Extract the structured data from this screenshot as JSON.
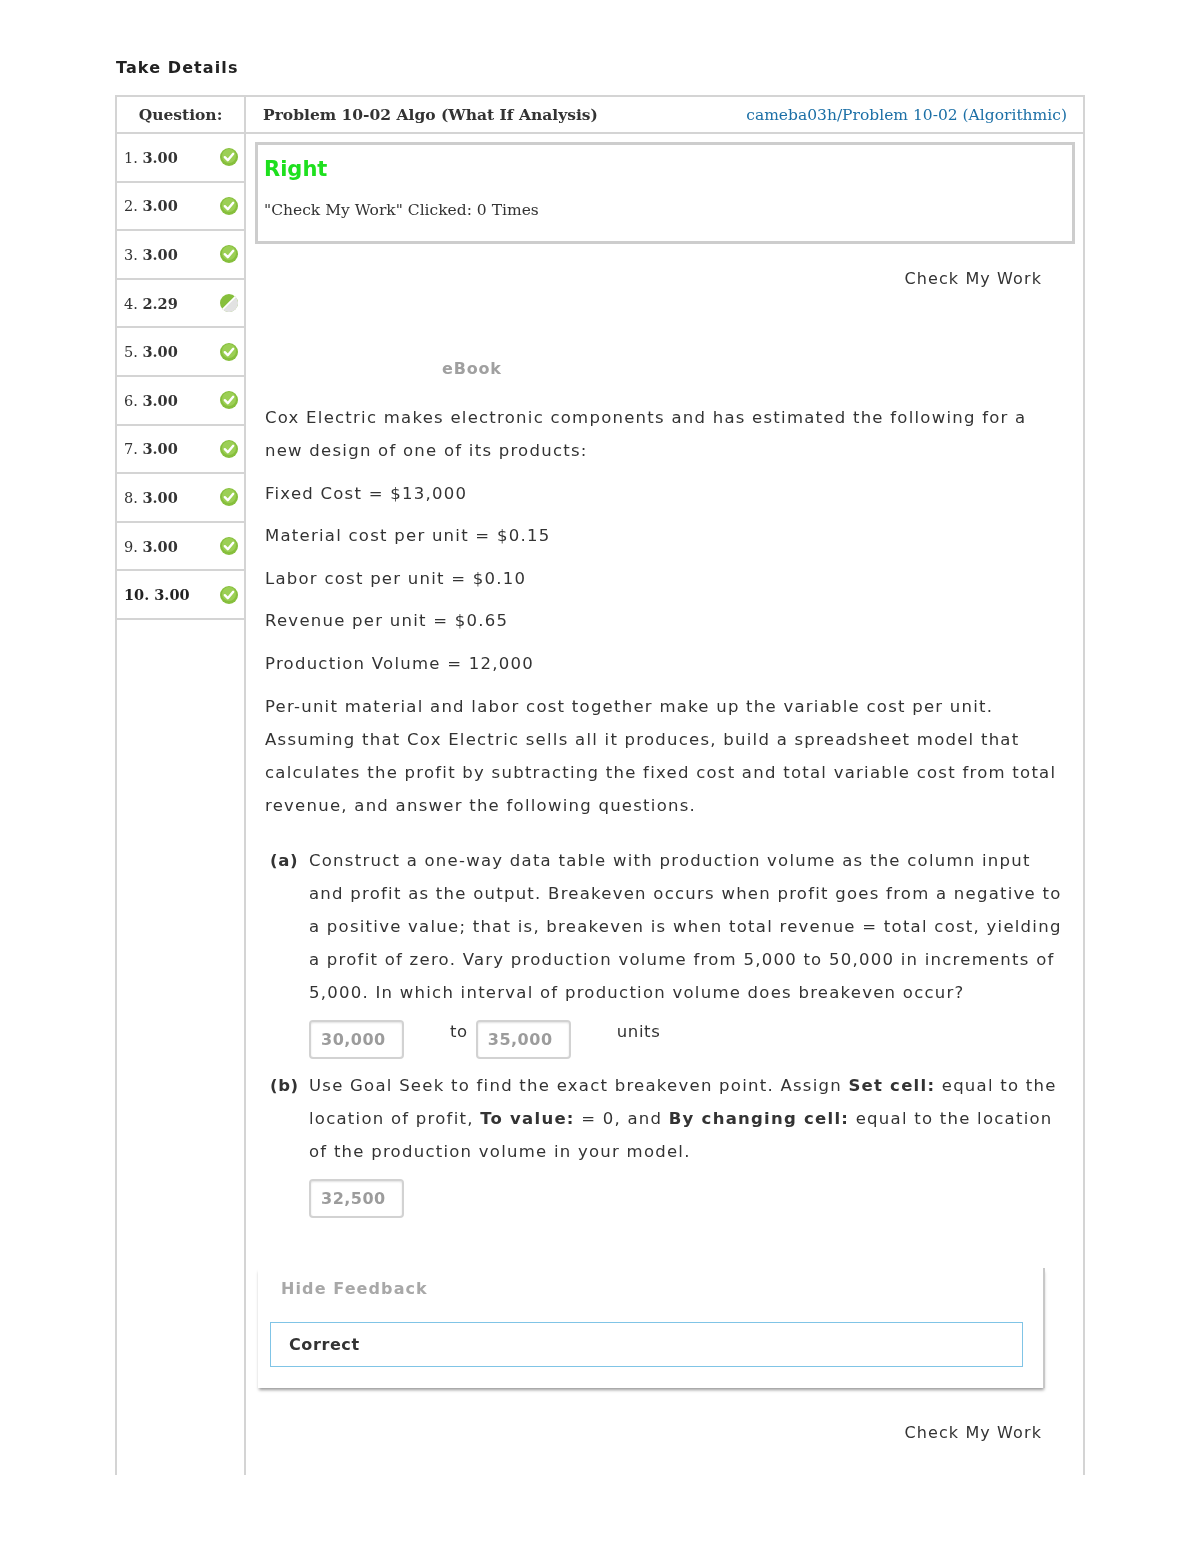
{
  "page_title": "Take Details",
  "questions": {
    "heading": "Question:",
    "items": [
      {
        "label": "1. **3.00**",
        "kind": "check",
        "selected": false
      },
      {
        "label": "2. **3.00**",
        "kind": "check",
        "selected": false
      },
      {
        "label": "3. **3.00**",
        "kind": "check",
        "selected": false
      },
      {
        "label": "4. **2.29**",
        "kind": "partial",
        "selected": false
      },
      {
        "label": "5. **3.00**",
        "kind": "check",
        "selected": false
      },
      {
        "label": "6. **3.00**",
        "kind": "check",
        "selected": false
      },
      {
        "label": "7. **3.00**",
        "kind": "check",
        "selected": false
      },
      {
        "label": "8. **3.00**",
        "kind": "check",
        "selected": false
      },
      {
        "label": "9. **3.00**",
        "kind": "check",
        "selected": false
      },
      {
        "label": "10. **3.00**",
        "kind": "check",
        "selected": true
      }
    ]
  },
  "problem": {
    "title": "Problem 10-02 Algo (What If Analysis)",
    "link": "cameba03h/Problem 10-02 (Algorithmic)"
  },
  "result": {
    "verdict": "Right",
    "correct": true,
    "clicks": "\"Check My Work\" Clicked: 0 Times"
  },
  "check_top": "Check My Work",
  "ebook": "eBook",
  "intro": "Cox Electric makes electronic components and has estimated the following for a new design of one of its products:",
  "givens": [
    "Fixed Cost = $13,000",
    "Material cost per unit = $0.15",
    "Labor cost per unit = $0.10",
    "Revenue per unit = $0.65",
    "Production Volume = 12,000"
  ],
  "instructions": "Per-unit material and labor cost together make up the variable cost per unit. Assuming that Cox Electric sells all it produces, build a spreadsheet model that calculates the profit by subtracting the fixed cost and total variable cost from total revenue, and answer the following questions.",
  "parts": [
    {
      "marker": "(a)",
      "text": "Construct a one-way data table with production volume as the column input and profit as the output. Breakeven occurs when profit goes from a negative to a positive value; that is, breakeven is when total revenue = total cost, yielding a profit of zero. Vary production volume from 5,000 to 50,000 in increments of 5,000. In which interval of production volume does breakeven occur?",
      "answers": [
        {
          "kind": "field",
          "value": "30,000",
          "disabled": true
        },
        {
          "kind": "text",
          "text": "to"
        },
        {
          "kind": "field",
          "value": "35,000",
          "disabled": true
        },
        {
          "kind": "text",
          "text": "units"
        }
      ]
    },
    {
      "marker": "(b)",
      "text": "Use Goal Seek to find the exact breakeven point. Assign **Set cell:** equal to the location of profit, **To value:** = 0, and **By changing cell:** equal to the location of the production volume in your model.",
      "answers": [
        {
          "kind": "field",
          "value": "32,500",
          "disabled": true
        }
      ]
    }
  ],
  "feedback": {
    "toggle": "Hide Feedback",
    "message": "Correct"
  },
  "check_bottom": "Check My Work"
}
